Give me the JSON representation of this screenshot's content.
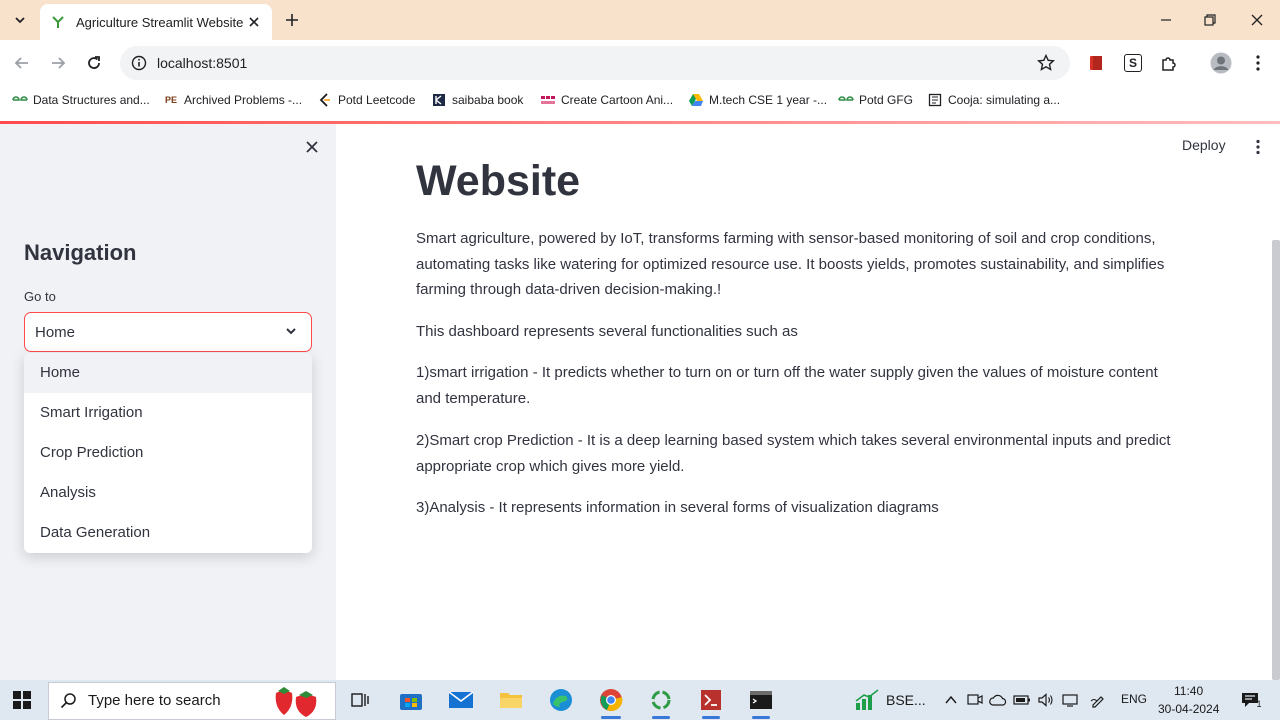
{
  "browser": {
    "tab": {
      "title": "Agriculture Streamlit Website"
    },
    "url": "localhost:8501",
    "bookmarks": [
      {
        "label": "Data Structures and...",
        "icon": "gfg-icon"
      },
      {
        "label": "Archived Problems -...",
        "icon": "pe-icon",
        "icon_text": "PE"
      },
      {
        "label": "Potd Leetcode",
        "icon": "leetcode-icon"
      },
      {
        "label": "saibaba book",
        "icon": "kindle-icon"
      },
      {
        "label": "Create Cartoon Ani...",
        "icon": "animation-icon"
      },
      {
        "label": "M.tech CSE 1 year -...",
        "icon": "google-drive-icon"
      },
      {
        "label": "Potd GFG",
        "icon": "gfg-icon"
      },
      {
        "label": "Cooja: simulating a...",
        "icon": "document-icon"
      }
    ],
    "extensions": {
      "s_icon_text": "S"
    }
  },
  "app": {
    "accent_color": "#ff4b4b",
    "sidebar": {
      "heading": "Navigation",
      "select_label": "Go to",
      "selected": "Home",
      "options": [
        "Home",
        "Smart Irrigation",
        "Crop Prediction",
        "Analysis",
        "Data Generation"
      ]
    },
    "header": {
      "deploy_label": "Deploy"
    },
    "main": {
      "title": "Website",
      "paragraphs": [
        "Smart agriculture, powered by IoT, transforms farming with sensor-based monitoring of soil and crop conditions, automating tasks like watering for optimized resource use. It boosts yields, promotes sustainability, and simplifies farming through data-driven decision-making.!",
        "This dashboard represents several functionalities such as",
        "1)smart irrigation - It predicts whether to turn on or turn off the water supply given the values of moisture content and temperature.",
        "2)Smart crop Prediction - It is a deep learning based system which takes several environmental inputs and predict appropriate crop which gives more yield.",
        "3)Analysis - It represents information in several forms of visualization diagrams"
      ]
    }
  },
  "taskbar": {
    "search_placeholder": "Type here to search",
    "stock_label": "BSE...",
    "language": "ENG",
    "time": "11:40",
    "date": "30-04-2024",
    "notification_count": "1"
  }
}
